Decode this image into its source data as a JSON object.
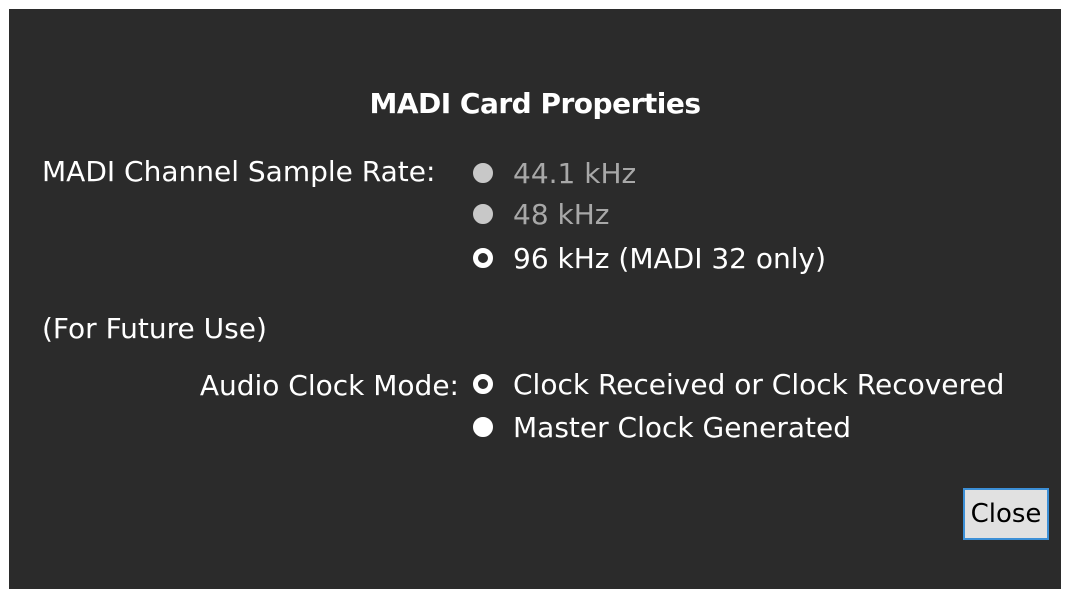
{
  "dialog": {
    "title": "MADI Card Properties"
  },
  "sample_rate": {
    "label": "MADI Channel Sample Rate:",
    "options": [
      {
        "label": "44.1 kHz",
        "state": "disabled"
      },
      {
        "label": "48 kHz",
        "state": "disabled"
      },
      {
        "label": "96 kHz (MADI 32 only)",
        "state": "selected"
      }
    ]
  },
  "future_use": {
    "label": "(For Future Use)"
  },
  "clock_mode": {
    "label": "Audio Clock Mode:",
    "options": [
      {
        "label": "Clock Received or Clock Recovered",
        "state": "selected"
      },
      {
        "label": "Master Clock Generated",
        "state": "unselected"
      }
    ]
  },
  "buttons": {
    "close_label": "Close"
  },
  "colors": {
    "background": "#2b2b2b",
    "text": "#ffffff",
    "disabled_text": "#a8a8a8",
    "button_border": "#3c8fd6"
  }
}
